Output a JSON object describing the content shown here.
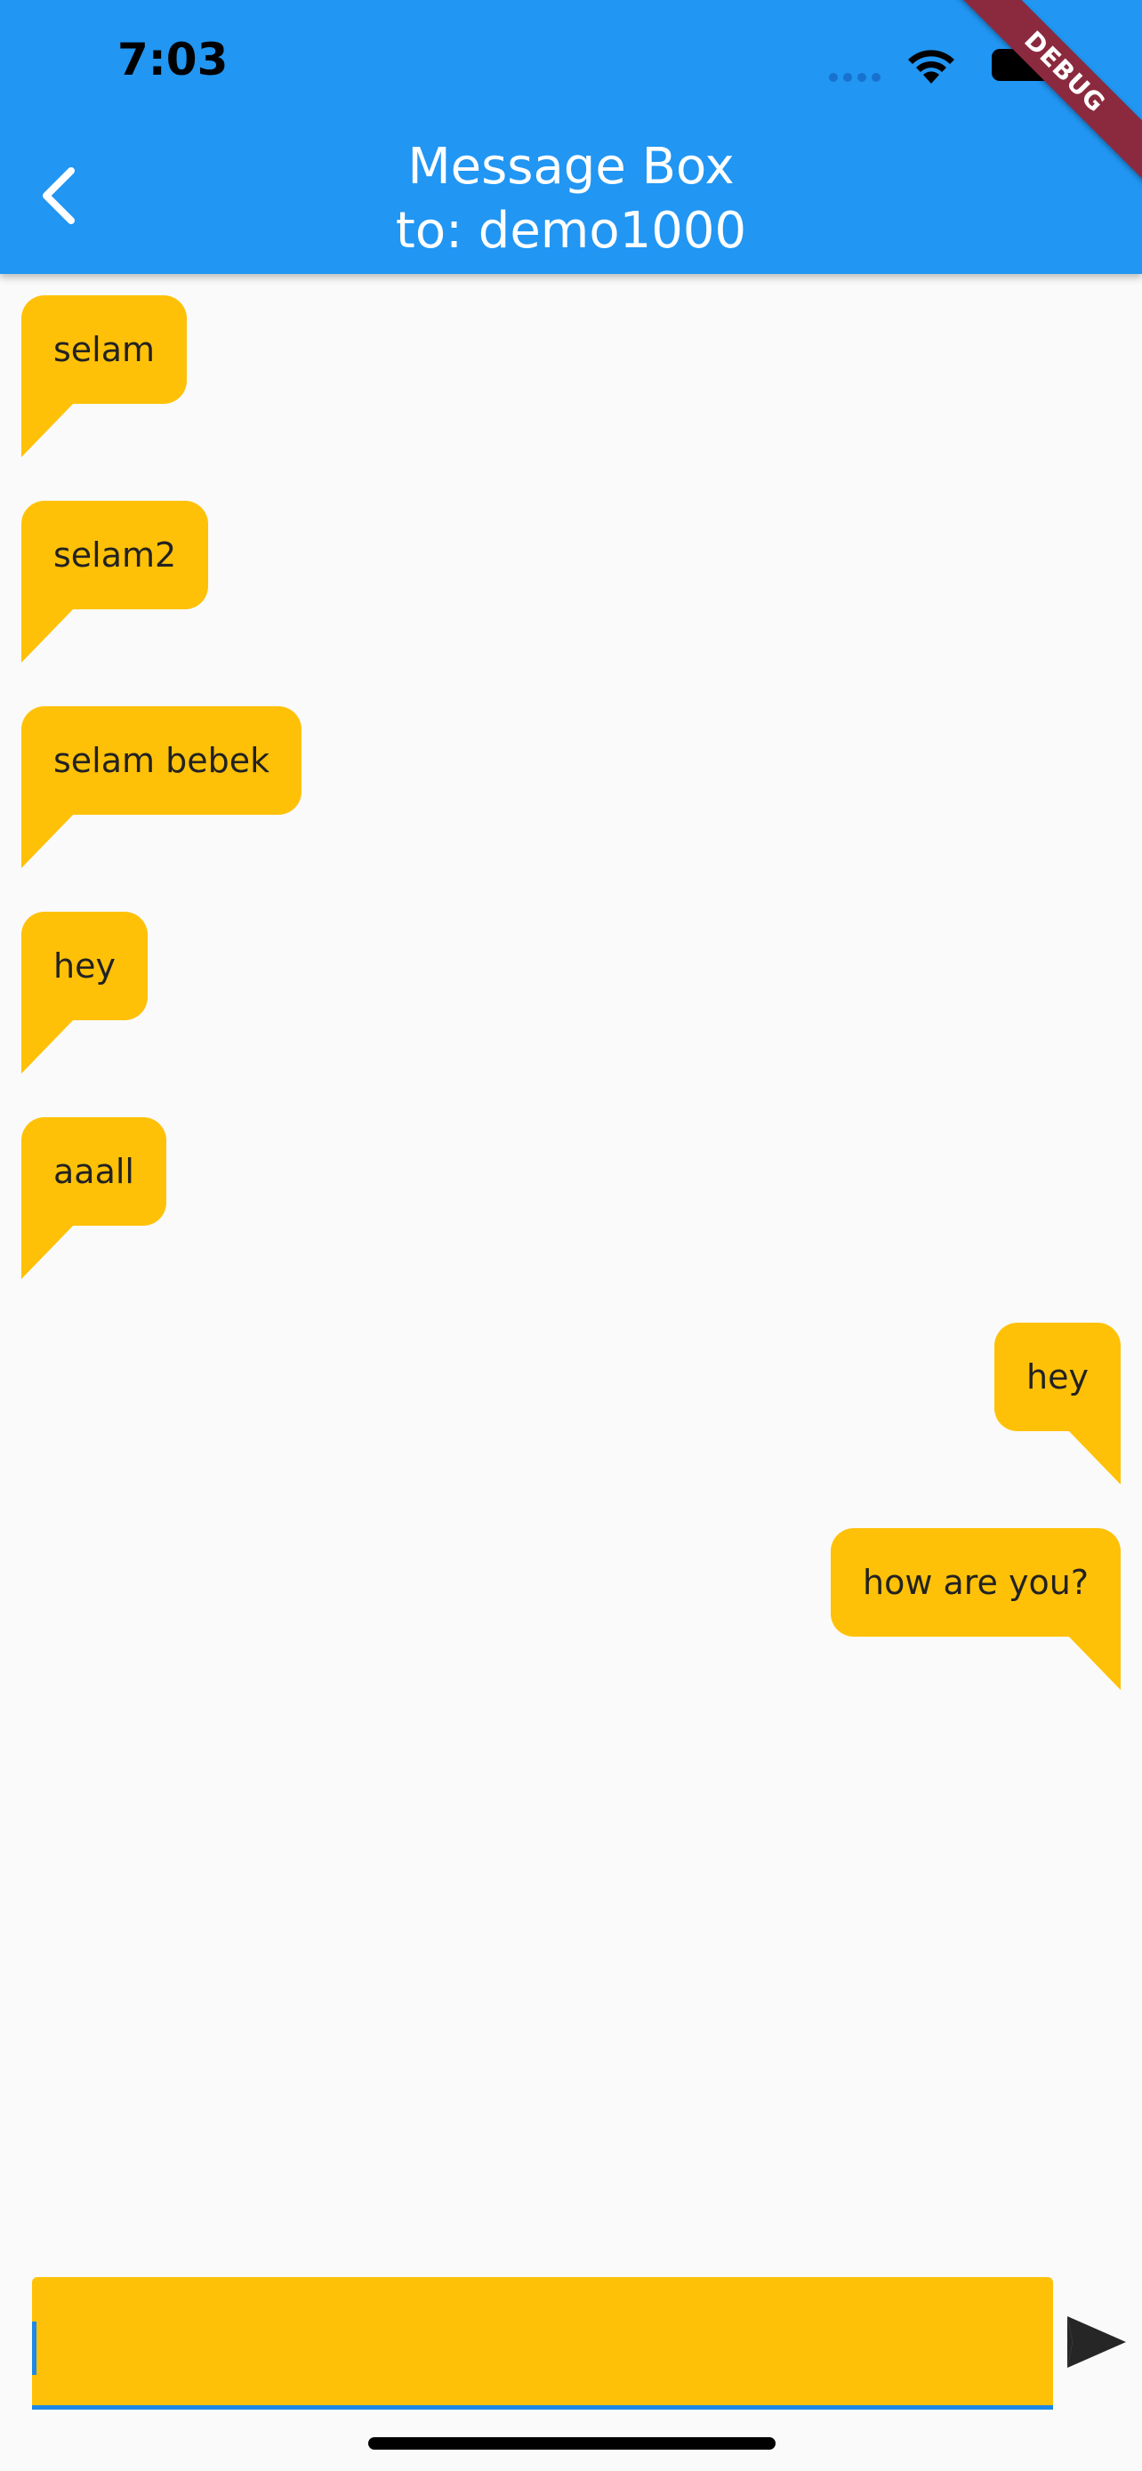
{
  "status_bar": {
    "time": "7:03"
  },
  "app_bar": {
    "title_line1": "Message Box",
    "title_line2": "to: demo1000",
    "debug_banner": "DEBUG"
  },
  "messages": [
    {
      "text": "selam",
      "direction": "incoming"
    },
    {
      "text": "selam2",
      "direction": "incoming"
    },
    {
      "text": "selam bebek",
      "direction": "incoming"
    },
    {
      "text": "hey",
      "direction": "incoming"
    },
    {
      "text": "aaall",
      "direction": "incoming"
    },
    {
      "text": "hey",
      "direction": "outgoing"
    },
    {
      "text": "how are you?",
      "direction": "outgoing"
    }
  ],
  "composer": {
    "value": "",
    "placeholder": ""
  },
  "icons": {
    "back": "chevron-left-icon",
    "send": "send-icon",
    "wifi": "wifi-icon",
    "battery": "battery-icon",
    "signal": "cellular-signal-icon"
  },
  "colors": {
    "app_bar": "#2196f3",
    "bubble": "#ffc107",
    "background": "#fafafa",
    "input_underline": "#1e88e5",
    "debug_banner": "#8b2a3e"
  }
}
